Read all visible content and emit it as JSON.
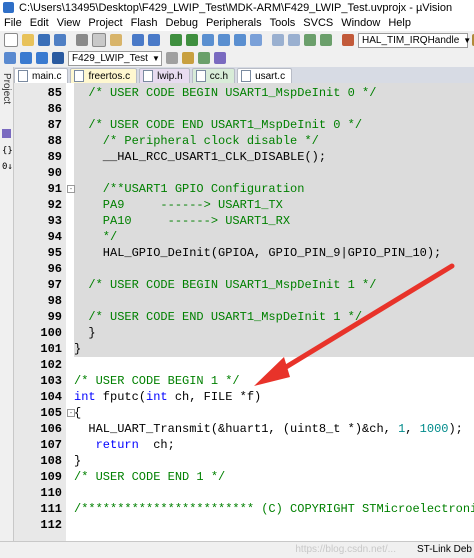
{
  "window": {
    "title": "C:\\Users\\13495\\Desktop\\F429_LWIP_Test\\MDK-ARM\\F429_LWIP_Test.uvprojx - µVision"
  },
  "menu": [
    "File",
    "Edit",
    "View",
    "Project",
    "Flash",
    "Debug",
    "Peripherals",
    "Tools",
    "SVCS",
    "Window",
    "Help"
  ],
  "toolbar": {
    "function_combo": "HAL_TIM_IRQHandle",
    "target_combo": "F429_LWIP_Test"
  },
  "left_panel": {
    "label": "Project"
  },
  "tabs": [
    {
      "label": "main.c",
      "color": "#ffffff"
    },
    {
      "label": "freertos.c",
      "color": "#fff8d0"
    },
    {
      "label": "lwip.h",
      "color": "#e8dcf0"
    },
    {
      "label": "cc.h",
      "color": "#d8ecd8"
    },
    {
      "label": "usart.c",
      "color": "#ffffff"
    }
  ],
  "code_lines": [
    {
      "num": "85",
      "fold": "",
      "text": "  /* USER CODE BEGIN USART1_MspDeInit 0 */"
    },
    {
      "num": "86",
      "fold": "",
      "text": ""
    },
    {
      "num": "87",
      "fold": "",
      "text": "  /* USER CODE END USART1_MspDeInit 0 */"
    },
    {
      "num": "88",
      "fold": "",
      "text": "    /* Peripheral clock disable */"
    },
    {
      "num": "89",
      "fold": "",
      "text": "    __HAL_RCC_USART1_CLK_DISABLE();"
    },
    {
      "num": "90",
      "fold": "",
      "text": ""
    },
    {
      "num": "91",
      "fold": "-",
      "text": "    /**USART1 GPIO Configuration"
    },
    {
      "num": "92",
      "fold": "",
      "text": "    PA9     ------> USART1_TX"
    },
    {
      "num": "93",
      "fold": "",
      "text": "    PA10     ------> USART1_RX"
    },
    {
      "num": "94",
      "fold": "",
      "text": "    */"
    },
    {
      "num": "95",
      "fold": "",
      "text": "    HAL_GPIO_DeInit(GPIOA, GPIO_PIN_9|GPIO_PIN_10);"
    },
    {
      "num": "96",
      "fold": "",
      "text": ""
    },
    {
      "num": "97",
      "fold": "",
      "text": "  /* USER CODE BEGIN USART1_MspDeInit 1 */"
    },
    {
      "num": "98",
      "fold": "",
      "text": ""
    },
    {
      "num": "99",
      "fold": "",
      "text": "  /* USER CODE END USART1_MspDeInit 1 */"
    },
    {
      "num": "100",
      "fold": "",
      "text": "  }"
    },
    {
      "num": "101",
      "fold": "",
      "text": "}"
    },
    {
      "num": "102",
      "fold": "",
      "text": ""
    },
    {
      "num": "103",
      "fold": "",
      "text": "/* USER CODE BEGIN 1 */"
    },
    {
      "num": "104",
      "fold": "",
      "text": "int fputc(int ch, FILE *f)"
    },
    {
      "num": "105",
      "fold": "-",
      "text": "{"
    },
    {
      "num": "106",
      "fold": "",
      "text": "  HAL_UART_Transmit(&huart1, (uint8_t *)&ch, 1, 1000);"
    },
    {
      "num": "107",
      "fold": "",
      "text": "   return  ch;"
    },
    {
      "num": "108",
      "fold": "",
      "text": "}"
    },
    {
      "num": "109",
      "fold": "",
      "text": "/* USER CODE END 1 */"
    },
    {
      "num": "110",
      "fold": "",
      "text": ""
    },
    {
      "num": "111",
      "fold": "",
      "text": "/************************ (C) COPYRIGHT STMicroelectronics *****END"
    },
    {
      "num": "112",
      "fold": "",
      "text": ""
    }
  ],
  "status": {
    "right": "ST-Link Deb",
    "watermark": "https://blog.csdn.net/..."
  },
  "annotation": {
    "color": "#e8332a"
  }
}
